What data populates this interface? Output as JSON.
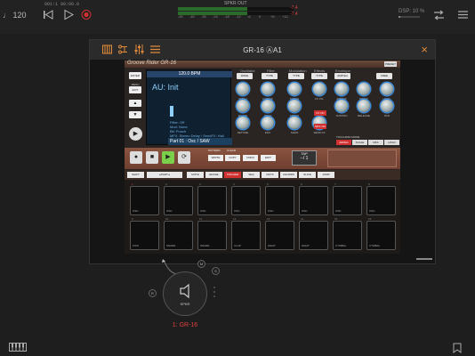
{
  "transport": {
    "tempo": "♩ 120",
    "position": "001:1  00:00.0",
    "meter_title": "SPKR OUT",
    "meter_scale": [
      "-60",
      "-40",
      "-30",
      "-24",
      "-18",
      "-12",
      "-6",
      "0",
      "+6",
      "+12"
    ],
    "meter_level": 0.6,
    "peak_left": "-7.4",
    "peak_right": "-7.4",
    "dsp_label": "DSP: 10 %",
    "dsp_value": 0.1
  },
  "plugin_window": {
    "title": "GR-16 ⒶA1",
    "close_label": "×"
  },
  "synth": {
    "brand": "Groove Rider GR-16",
    "header_badge": "PRESET",
    "side_buttons": [
      "ENTER",
      "MENU",
      "EXIT"
    ],
    "display": {
      "bpm": "120.0 BPM",
      "preset": "AU: Init",
      "fx_lines": [
        "Filter: Off",
        "Mod: None",
        "Bit: Punch"
      ],
      "mfx": "MFX: Stereo Delay / SendFX: Hall",
      "part": "Part 01 : Osc / SAW"
    },
    "sections": [
      "Oscillator",
      "Filter",
      "Modulation",
      "Effects",
      "Envelope"
    ],
    "types": [
      "WAVE",
      "TYPE",
      "TYPE",
      "TYPE",
      "AMP EG",
      "FREE"
    ],
    "knob_rows": [
      [
        "PITCH",
        "CUTOFF",
        "DEPTH",
        "FX LVL",
        "ATTACK",
        "DECAY",
        "LEVEL"
      ],
      [
        "PHASE",
        "RESO",
        "SPEED",
        "",
        "SUSTAIN",
        "RELEASE",
        "PAN"
      ],
      [
        "DETUNE",
        "ENV",
        "SLEW",
        "SEND FX",
        "",
        "",
        ""
      ]
    ],
    "fx_on_label": "FX ON",
    "mfx_on_label": "MFX ON",
    "touchpad_label": "TOUCHPAD MODE",
    "touchpad_modes": [
      "ARPEG",
      "SCALE",
      "MFX",
      "HOLD"
    ],
    "transport_labels": {
      "pattern": "PATTERN",
      "clear": "CLEAR",
      "write": "WRITE",
      "copy": "COPY",
      "undo": "UNDO",
      "edit": "EDIT",
      "tap": "TAP",
      "tap_value": "--/ 1"
    },
    "segment_buttons": [
      "SHIFT",
      "◂ PART ▸",
      "MUTE",
      "ERASE",
      "TRIGGER",
      "SEQ",
      "KEYS",
      "CHORDS",
      "SLICE",
      "JUMP"
    ],
    "pads_top": [
      "OSC",
      "OSC",
      "OSC",
      "OSC",
      "OSC",
      "OSC",
      "OSC",
      "OSC"
    ],
    "pads_bottom": [
      "KICK",
      "SNARE",
      "SNARE",
      "CLAP",
      "HIHAT",
      "HIHAT",
      "CYMBAL",
      "CYMBAL"
    ],
    "pad_numbers_top": [
      "1",
      "2",
      "3",
      "4",
      "5",
      "6",
      "7",
      "8"
    ],
    "pad_numbers_bottom": [
      "9",
      "10",
      "11",
      "12",
      "13",
      "14",
      "15",
      "16"
    ]
  },
  "node": {
    "speaker_label": "SPKR",
    "name": "1: GR-16",
    "badges": [
      "M",
      "S",
      "R"
    ]
  }
}
